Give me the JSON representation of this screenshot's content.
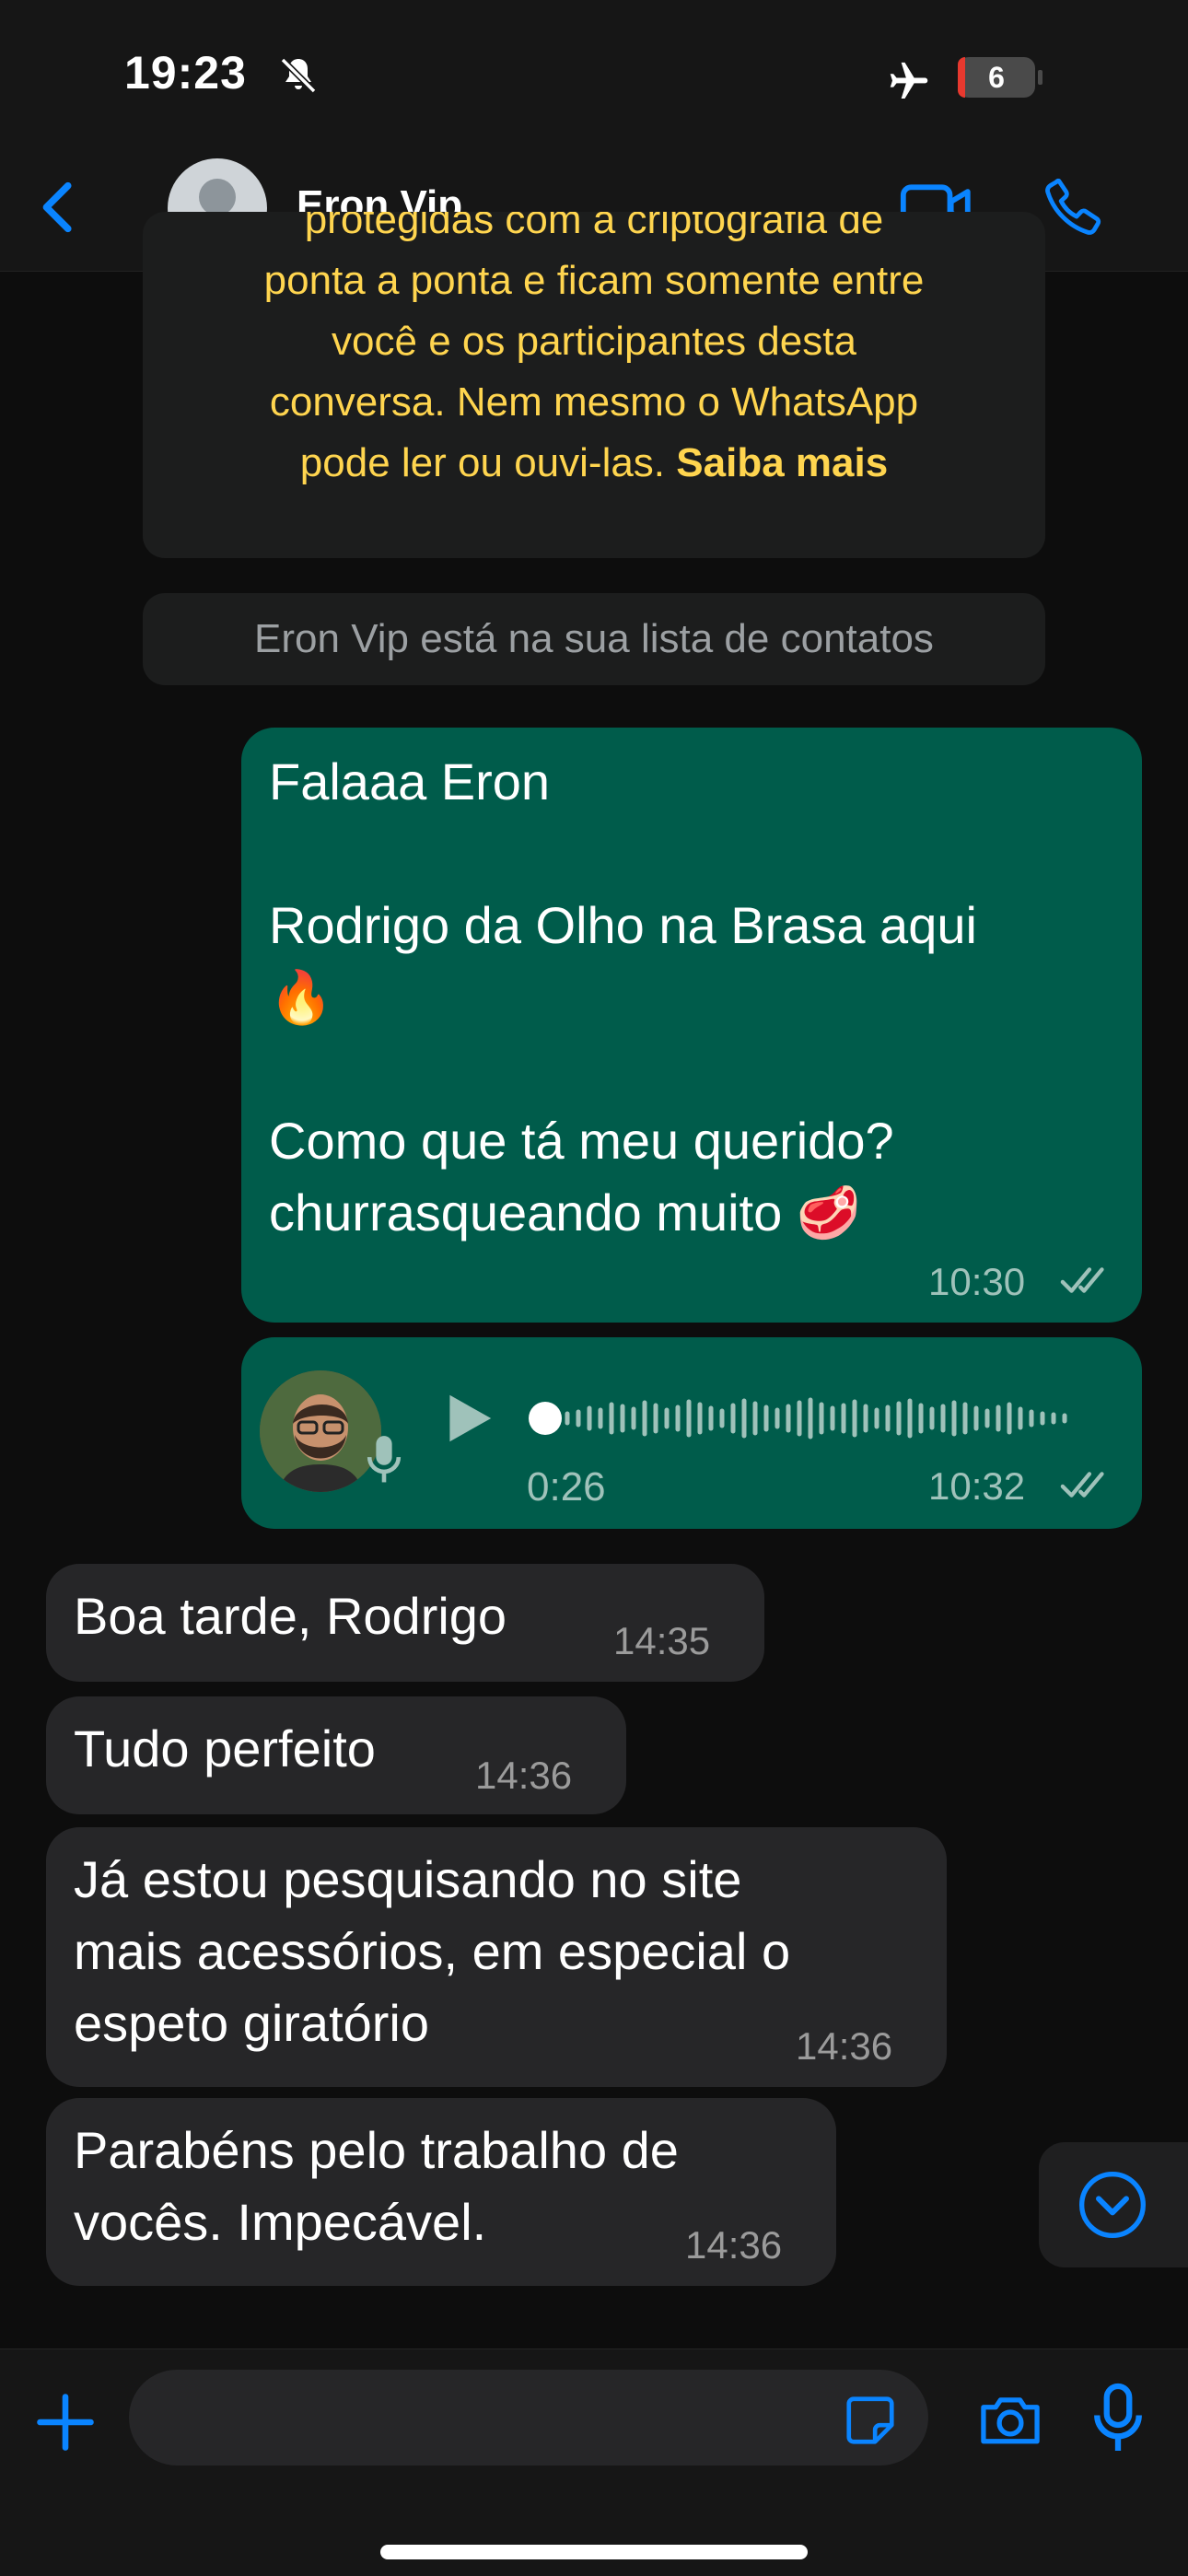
{
  "status_bar": {
    "time": "19:23",
    "battery": "6"
  },
  "header": {
    "contact_name": "Eron Vip"
  },
  "encryption_notice": {
    "lines": [
      "protegidas com a criptografia de",
      "ponta a ponta e ficam somente entre",
      "você e os participantes desta",
      "conversa. Nem mesmo o WhatsApp",
      "pode ler ou ouvi-las."
    ],
    "link": "Saiba mais"
  },
  "contact_notice": "Eron Vip está na sua lista de contatos",
  "messages": [
    {
      "direction": "out",
      "lines": [
        "Falaaa Eron",
        "",
        "Rodrigo da Olho na Brasa aqui",
        "🔥",
        "",
        "Como que tá meu querido?",
        "churrasqueando muito 🥩"
      ],
      "time": "10:30"
    },
    {
      "direction": "out",
      "type": "voice",
      "duration": "0:26",
      "time": "10:32"
    },
    {
      "direction": "in",
      "lines": [
        "Boa tarde, Rodrigo"
      ],
      "time": "14:35"
    },
    {
      "direction": "in",
      "lines": [
        "Tudo perfeito"
      ],
      "time": "14:36"
    },
    {
      "direction": "in",
      "lines": [
        "Já estou pesquisando no site",
        "mais acessórios, em especial o",
        "espeto giratório"
      ],
      "time": "14:36"
    },
    {
      "direction": "in",
      "lines": [
        "Parabéns pelo trabalho de",
        "vocês. Impecável."
      ],
      "time": "14:36"
    }
  ],
  "composer": {
    "placeholder": ""
  },
  "colors": {
    "accent": "#0a84ff",
    "outgoing_bubble": "#005c4b",
    "incoming_bubble": "#262628",
    "encryption_text": "#ffd54f"
  },
  "icons": [
    "back-chevron-icon",
    "default-avatar-icon",
    "video-call-icon",
    "phone-call-icon",
    "mute-bell-icon",
    "airplane-icon",
    "read-ticks-icon",
    "play-icon",
    "microphone-icon",
    "chevron-down-circle-icon",
    "plus-icon",
    "sticker-icon",
    "camera-icon"
  ]
}
